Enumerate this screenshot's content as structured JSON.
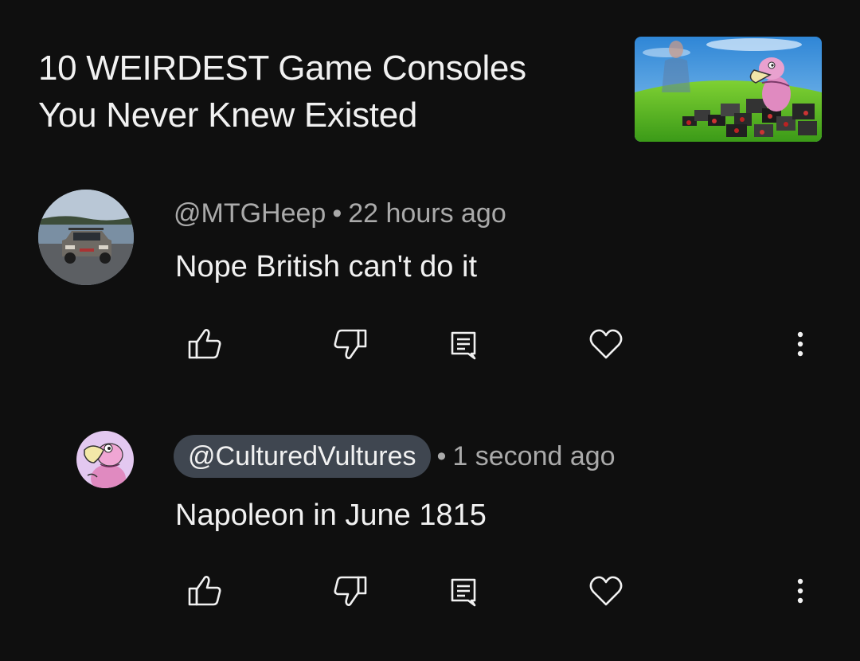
{
  "video": {
    "title_line1": "10 WEIRDEST Game Consoles",
    "title_line2": "You Never Knew Existed",
    "thumbnail_icon": "video-thumbnail"
  },
  "comments": [
    {
      "author": "@MTGHeep",
      "separator": "•",
      "time": "22 hours ago",
      "text": "Nope British can't do it",
      "avatar_icon": "car-photo-avatar"
    },
    {
      "author": "@CulturedVultures",
      "separator": "•",
      "time": "1 second ago",
      "text": "Napoleon in June 1815",
      "avatar_icon": "vulture-cartoon-avatar",
      "author_highlighted": true
    }
  ],
  "actions": {
    "like_icon": "thumbs-up-icon",
    "dislike_icon": "thumbs-down-icon",
    "reply_icon": "reply-icon",
    "heart_icon": "heart-icon",
    "more_icon": "more-vertical-icon"
  },
  "colors": {
    "background": "#0f0f0f",
    "primary_text": "#f1f1f1",
    "secondary_text": "#aaaaaa",
    "author_chip": "#3f4650"
  }
}
